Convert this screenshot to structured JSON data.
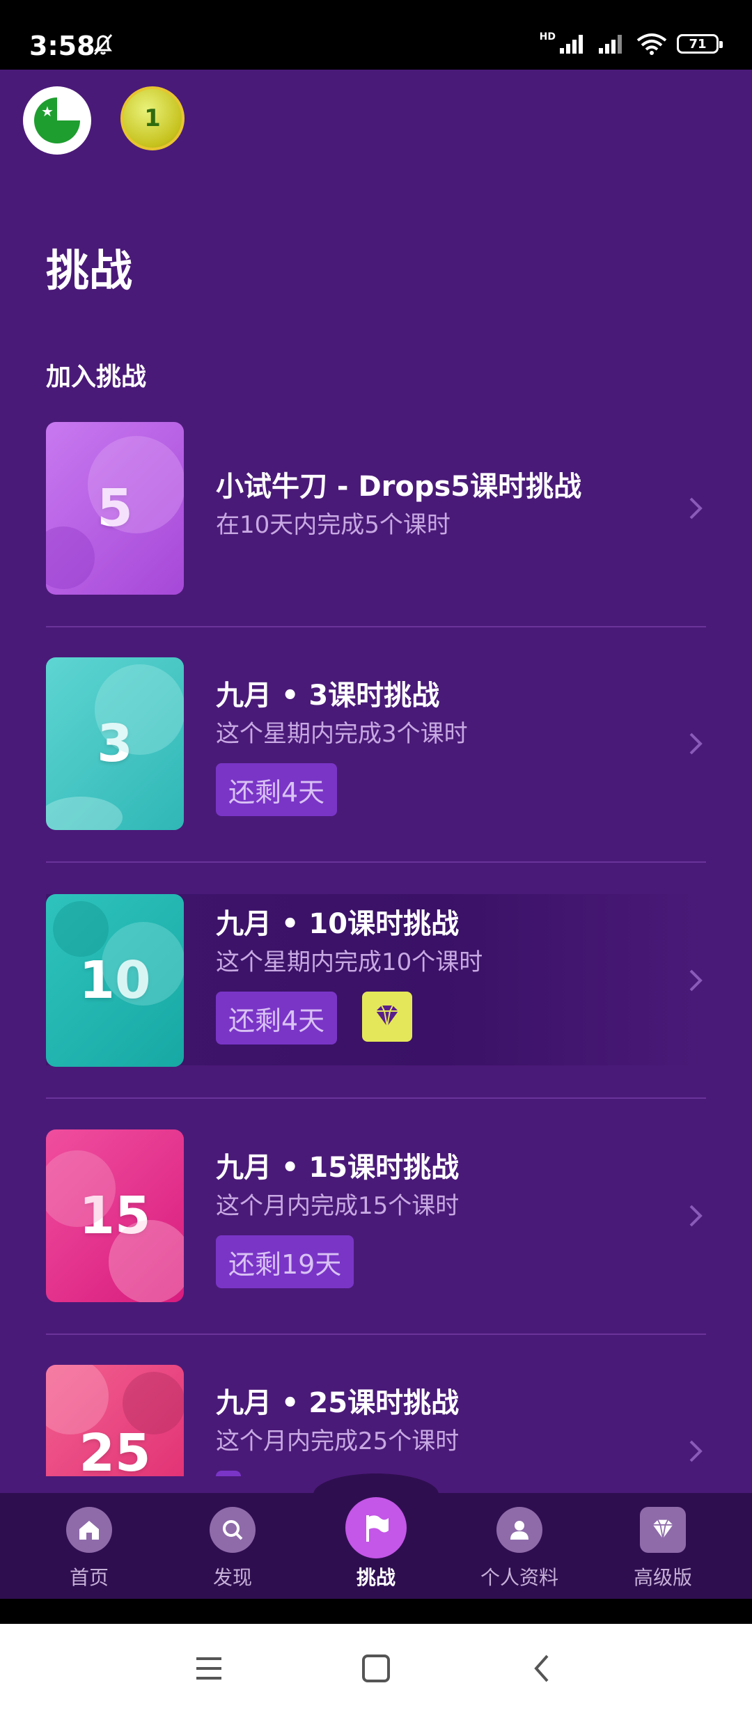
{
  "status_bar": {
    "time": "3:58",
    "hd_label": "HD",
    "battery": "71",
    "icons": [
      "bell-off-icon",
      "signal-icon",
      "signal-icon",
      "wifi-icon",
      "battery-icon"
    ]
  },
  "header": {
    "flag_icon": "esperanto-flag-icon",
    "level": "1"
  },
  "page_title": "挑战",
  "section_title": "加入挑战",
  "challenges": [
    {
      "number": "5",
      "title": "小试牛刀 - Drops5课时挑战",
      "description": "在10天内完成5个课时",
      "color": "#B257E0"
    },
    {
      "number": "3",
      "title": "九月 • 3课时挑战",
      "description": "这个星期内完成3个课时",
      "remaining": "还剩4天",
      "color": "#4CCBCB"
    },
    {
      "number": "10",
      "title": "九月 • 10课时挑战",
      "description": "这个星期内完成10个课时",
      "remaining": "还剩4天",
      "premium_icon": "diamond-icon",
      "color": "#22B6B0"
    },
    {
      "number": "15",
      "title": "九月 • 15课时挑战",
      "description": "这个月内完成15个课时",
      "remaining": "还剩19天",
      "color": "#E0288B"
    },
    {
      "number": "25",
      "title": "九月 • 25课时挑战",
      "description": "这个月内完成25个课时",
      "color": "#E53A7A"
    }
  ],
  "bottom_nav": [
    {
      "label": "首页",
      "icon": "home-icon"
    },
    {
      "label": "发现",
      "icon": "search-icon"
    },
    {
      "label": "挑战",
      "icon": "flag-icon",
      "active": true
    },
    {
      "label": "个人资料",
      "icon": "profile-icon"
    },
    {
      "label": "高级版",
      "icon": "diamond-icon"
    }
  ],
  "colors": {
    "background": "#4A1A78",
    "nav_background": "#2F0E50",
    "active_nav": "#C456E8",
    "remaining_badge": "#7A35C7",
    "premium_badge": "#E5E75A"
  }
}
